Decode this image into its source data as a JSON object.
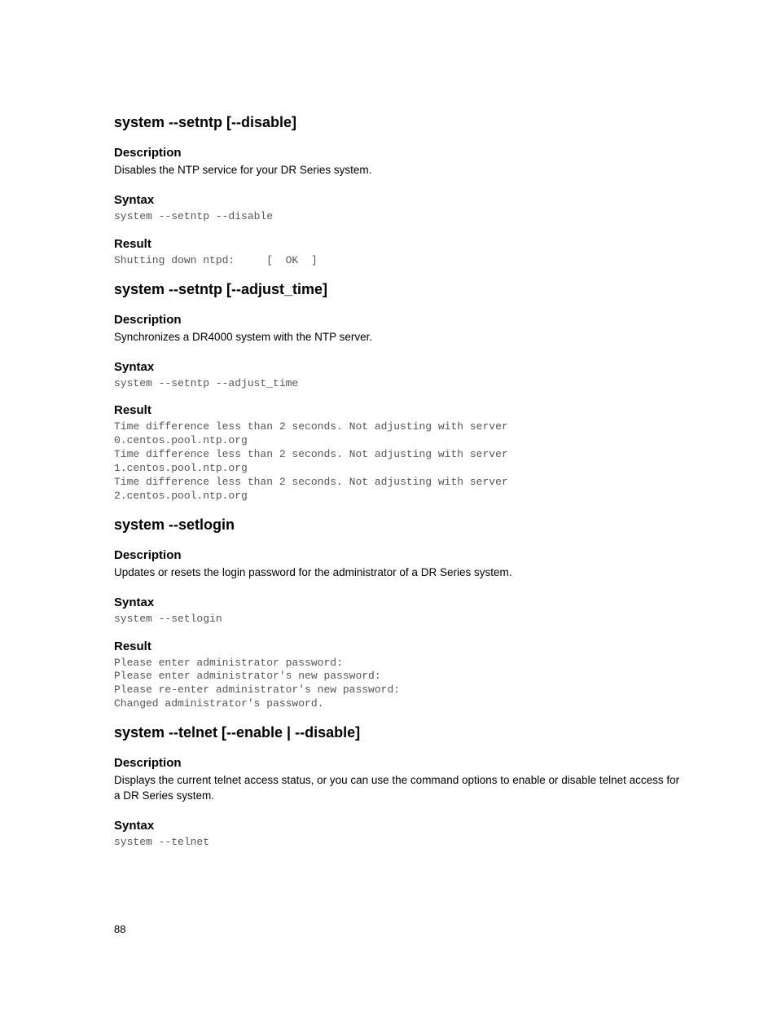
{
  "sections": [
    {
      "title": "system --setntp [--disable]",
      "blocks": [
        {
          "heading": "Description",
          "body": "Disables the NTP service for your DR Series system."
        },
        {
          "heading": "Syntax",
          "code": "system --setntp --disable"
        },
        {
          "heading": "Result",
          "code": "Shutting down ntpd:     [  OK  ]"
        }
      ]
    },
    {
      "title": "system --setntp [--adjust_time]",
      "blocks": [
        {
          "heading": "Description",
          "body": "Synchronizes a DR4000 system with the NTP server."
        },
        {
          "heading": "Syntax",
          "code": "system --setntp --adjust_time"
        },
        {
          "heading": "Result",
          "code": "Time difference less than 2 seconds. Not adjusting with server \n0.centos.pool.ntp.org\nTime difference less than 2 seconds. Not adjusting with server \n1.centos.pool.ntp.org\nTime difference less than 2 seconds. Not adjusting with server \n2.centos.pool.ntp.org"
        }
      ]
    },
    {
      "title": "system --setlogin",
      "blocks": [
        {
          "heading": "Description",
          "body": "Updates or resets the login password for the administrator of a DR Series system."
        },
        {
          "heading": "Syntax",
          "code": "system --setlogin"
        },
        {
          "heading": "Result",
          "code": "Please enter administrator password:\nPlease enter administrator's new password:\nPlease re-enter administrator's new password:\nChanged administrator's password."
        }
      ]
    },
    {
      "title": "system --telnet [--enable | --disable]",
      "blocks": [
        {
          "heading": "Description",
          "body": "Displays the current telnet access status, or you can use the command options to enable or disable telnet access for a DR Series system."
        },
        {
          "heading": "Syntax",
          "code": "system --telnet"
        }
      ]
    }
  ],
  "page_number": "88"
}
